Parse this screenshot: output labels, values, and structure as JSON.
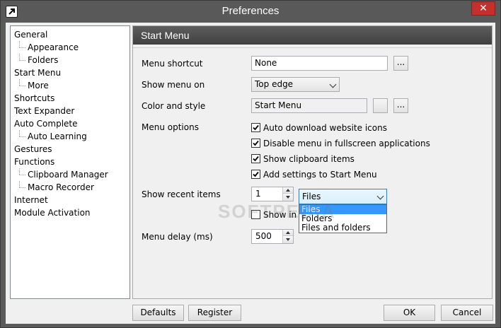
{
  "window": {
    "title": "Preferences",
    "close_glyph": "✕"
  },
  "tree": {
    "items": [
      {
        "label": "General",
        "level": 0
      },
      {
        "label": "Appearance",
        "level": 1
      },
      {
        "label": "Folders",
        "level": 1
      },
      {
        "label": "Start Menu",
        "level": 0,
        "selected": true
      },
      {
        "label": "More",
        "level": 1
      },
      {
        "label": "Shortcuts",
        "level": 0
      },
      {
        "label": "Text Expander",
        "level": 0
      },
      {
        "label": "Auto Complete",
        "level": 0
      },
      {
        "label": "Auto Learning",
        "level": 1
      },
      {
        "label": "Gestures",
        "level": 0
      },
      {
        "label": "Functions",
        "level": 0
      },
      {
        "label": "Clipboard Manager",
        "level": 1
      },
      {
        "label": "Macro Recorder",
        "level": 1
      },
      {
        "label": "Internet",
        "level": 0
      },
      {
        "label": "Module Activation",
        "level": 0
      }
    ]
  },
  "panel": {
    "title": "Start Menu",
    "menu_shortcut": {
      "label": "Menu shortcut",
      "value": "None",
      "browse": "..."
    },
    "show_menu_on": {
      "label": "Show menu on",
      "value": "Top edge"
    },
    "color_style": {
      "label": "Color and style",
      "value": "Start Menu",
      "browse": "..."
    },
    "menu_options": {
      "label": "Menu options",
      "items": [
        {
          "label": "Auto download website icons",
          "checked": true
        },
        {
          "label": "Disable menu in fullscreen applications",
          "checked": true
        },
        {
          "label": "Show clipboard items",
          "checked": true
        },
        {
          "label": "Add settings to Start Menu",
          "checked": true
        }
      ]
    },
    "recent_items": {
      "label": "Show recent items",
      "count": "1",
      "type_value": "Files",
      "options": [
        "Files",
        "Folders",
        "Files and folders"
      ],
      "highlighted": "Files"
    },
    "show_in": {
      "label": "Show in s",
      "checked": false
    },
    "menu_delay": {
      "label": "Menu delay (ms)",
      "value": "500"
    }
  },
  "watermark": "SOFTPEDIA",
  "buttons": {
    "defaults": "Defaults",
    "register": "Register",
    "ok": "OK",
    "cancel": "Cancel"
  }
}
